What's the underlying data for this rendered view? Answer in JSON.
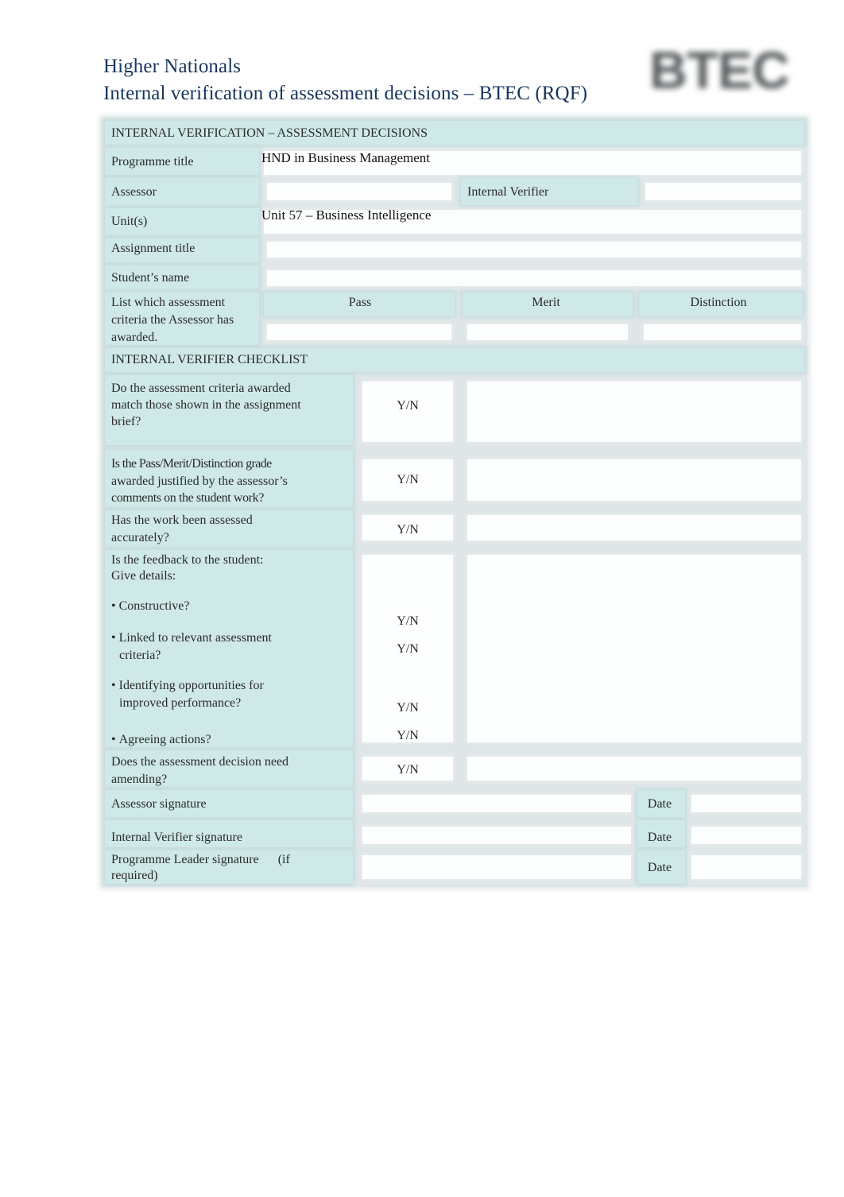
{
  "header": {
    "line1": "Higher Nationals",
    "line2": "Internal verification of assessment decisions – BTEC (RQF)",
    "logo_text": "BTEC"
  },
  "section1": {
    "title": "INTERNAL VERIFICATION – ASSESSMENT DECISIONS",
    "programme_title_label": "Programme title",
    "programme_title_value": "HND in Business Management",
    "assessor_label": "Assessor",
    "assessor_value": "",
    "internal_verifier_label": "Internal  Verifier",
    "internal_verifier_value": "",
    "units_label": "Unit(s)",
    "units_value": "Unit 57 – Business Intelligence",
    "assignment_title_label": "Assignment title",
    "assignment_title_value": "",
    "student_name_label": "Student’s name",
    "student_name_value": "",
    "criteria_label_lines": [
      "List which assessment",
      "criteria the Assessor   has",
      "awarded."
    ],
    "grade_columns": [
      "Pass",
      "Merit",
      "Distinction"
    ],
    "grade_values": [
      "",
      "",
      ""
    ]
  },
  "checklist": {
    "title": "INTERNAL VERIFIER CHECKLIST",
    "yn_label": "Y/N",
    "questions": [
      {
        "lines": [
          "Do the assessment criteria awarded",
          "match those shown in the   assignment",
          "brief?"
        ]
      },
      {
        "lines": [
          "Is the Pass/Merit/Distinction grade",
          "awarded justified   by the assessor’s",
          "comments on the student work?"
        ]
      },
      {
        "lines": [
          "Has the work been assessed",
          "accurately?"
        ]
      },
      {
        "lines": [
          "Is the feedback to the student:",
          "Give  details:"
        ],
        "bullets": [
          {
            "lines": [
              "Constructive?"
            ]
          },
          {
            "lines": [
              "Linked to relevant assessment",
              "criteria?"
            ]
          },
          {
            "lines": [
              "Identifying opportunities for",
              "improved performance?"
            ]
          },
          {
            "lines": [
              "Agreeing  actions?"
            ]
          }
        ]
      },
      {
        "lines": [
          "Does the assessment decision need",
          "amending?"
        ]
      }
    ]
  },
  "signatures": {
    "date_label": "Date",
    "rows": [
      {
        "label_lines": [
          "Assessor signature"
        ]
      },
      {
        "label_lines": [
          "Internal Verifier signature"
        ]
      },
      {
        "label_lines": [
          "Programme Leader signature      (if",
          "required)"
        ]
      }
    ]
  }
}
